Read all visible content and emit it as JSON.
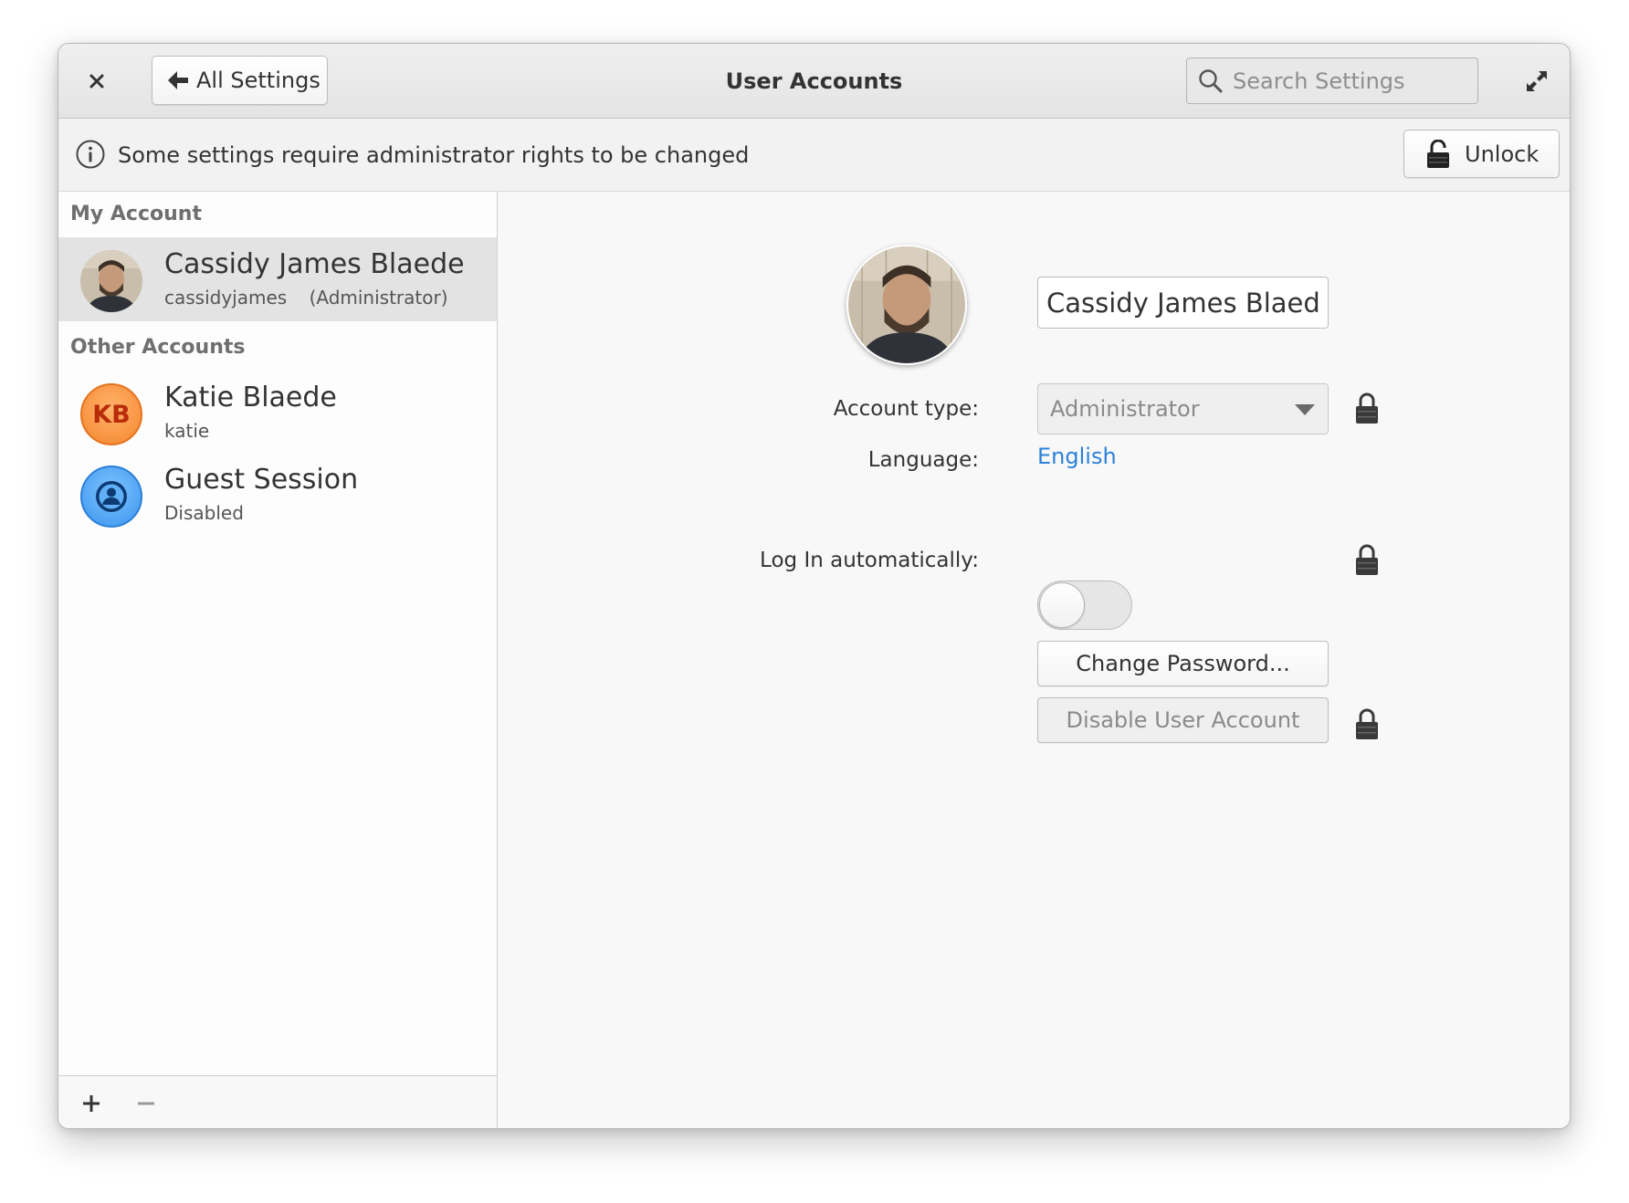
{
  "headerbar": {
    "back_label": "All Settings",
    "title": "User Accounts",
    "search_placeholder": "Search Settings"
  },
  "infobar": {
    "message": "Some settings require administrator rights to be changed",
    "unlock_label": "Unlock"
  },
  "sidebar": {
    "my_account_header": "My Account",
    "my_account": {
      "name": "Cassidy James Blaede",
      "username": "cassidyjames",
      "role": "(Administrator)",
      "selected": true
    },
    "other_accounts_header": "Other Accounts",
    "other_accounts": [
      {
        "name": "Katie Blaede",
        "sub": "katie",
        "initials": "KB",
        "avatar_color": "#f5852c"
      },
      {
        "name": "Guest Session",
        "sub": "Disabled",
        "icon": "user-icon",
        "avatar_color": "#3a95ee"
      }
    ],
    "footer": {
      "add_icon": "plus-icon",
      "remove_icon": "minus-icon"
    }
  },
  "content": {
    "full_name": "Cassidy James Blaede",
    "account_type_label": "Account type:",
    "account_type_value": "Administrator",
    "language_label": "Language:",
    "language_value": "English",
    "autologin_label": "Log In automatically:",
    "autologin_on": false,
    "change_password_label": "Change Password...",
    "disable_account_label": "Disable User Account"
  },
  "colors": {
    "accent_link": "#2b82d9",
    "selected_row": "#e3e3e3"
  }
}
